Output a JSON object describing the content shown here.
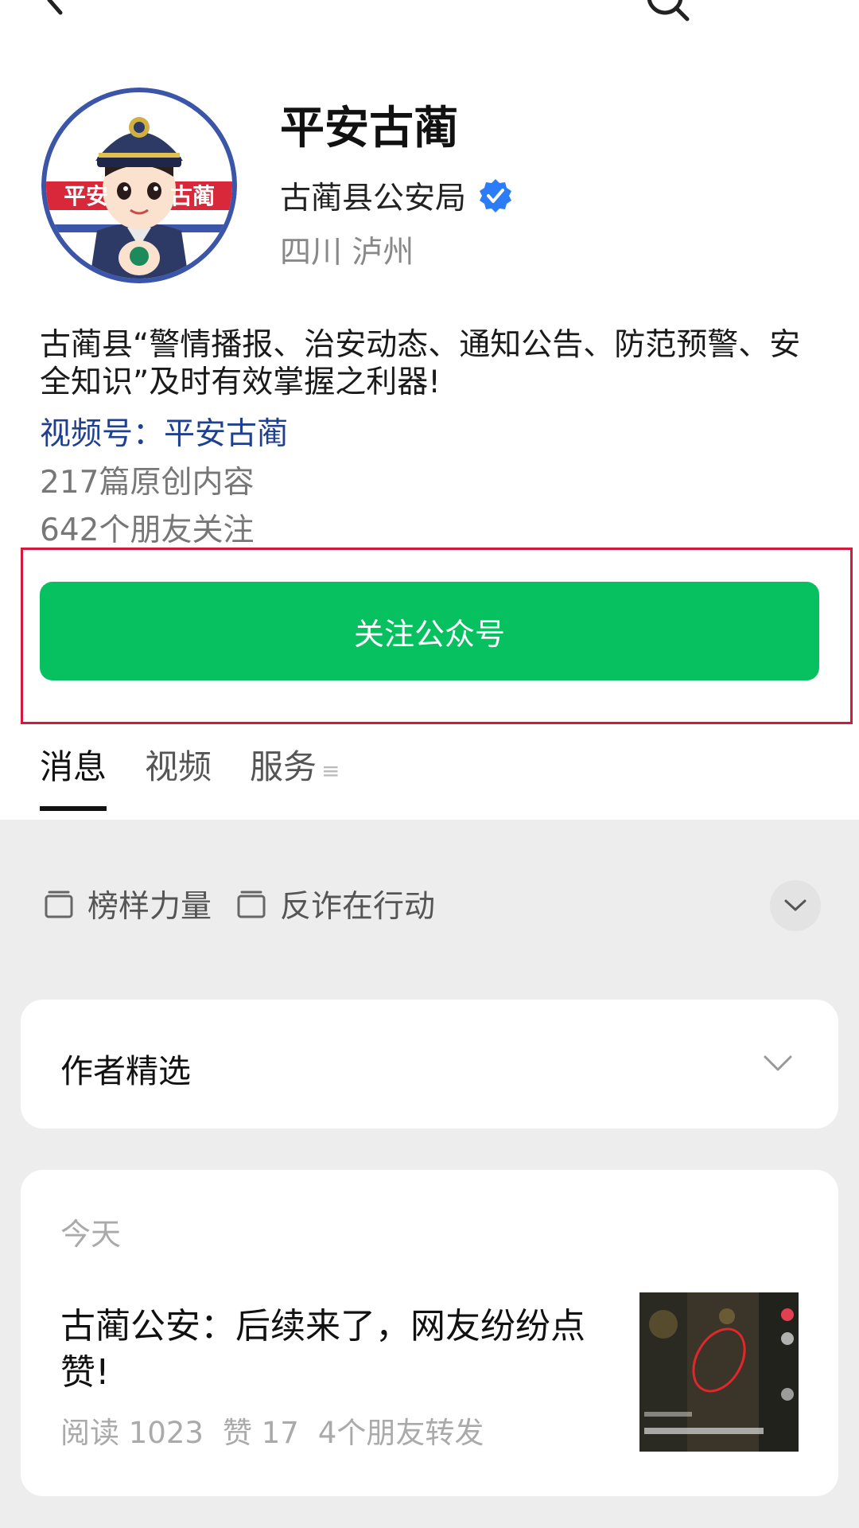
{
  "profile": {
    "name": "平安古蔺",
    "org": "古蔺县公安局",
    "location": "四川 泸州",
    "avatar_text_left": "平安",
    "avatar_text_right": "古蔺",
    "bio": "古蔺县“警情播报、治安动态、通知公告、防范预警、安全知识”及时有效掌握之利器!",
    "channel": "视频号：平安古蔺",
    "original_count": "217篇原创内容",
    "friends_follow": "642个朋友关注"
  },
  "actions": {
    "follow_label": "关注公众号"
  },
  "tabs": [
    {
      "label": "消息",
      "active": true
    },
    {
      "label": "视频",
      "active": false
    },
    {
      "label": "服务",
      "active": false
    }
  ],
  "collections": [
    "榜样力量",
    "反诈在行动"
  ],
  "picks": {
    "label": "作者精选"
  },
  "article": {
    "date": "今天",
    "title": "古蔺公安：后续来了，网友纷纷点赞!",
    "reads": "阅读 1023",
    "likes": "赞 17",
    "shares": "4个朋友转发"
  },
  "colors": {
    "accent_green": "#07c160",
    "link_blue": "#1f3f8f",
    "highlight_red": "#d3193d",
    "verified_blue": "#2b7cf6"
  },
  "icons": [
    "back-arrow-icon",
    "search-icon",
    "verified-icon",
    "folder-icon",
    "chevron-down-icon",
    "tab-more-icon"
  ]
}
